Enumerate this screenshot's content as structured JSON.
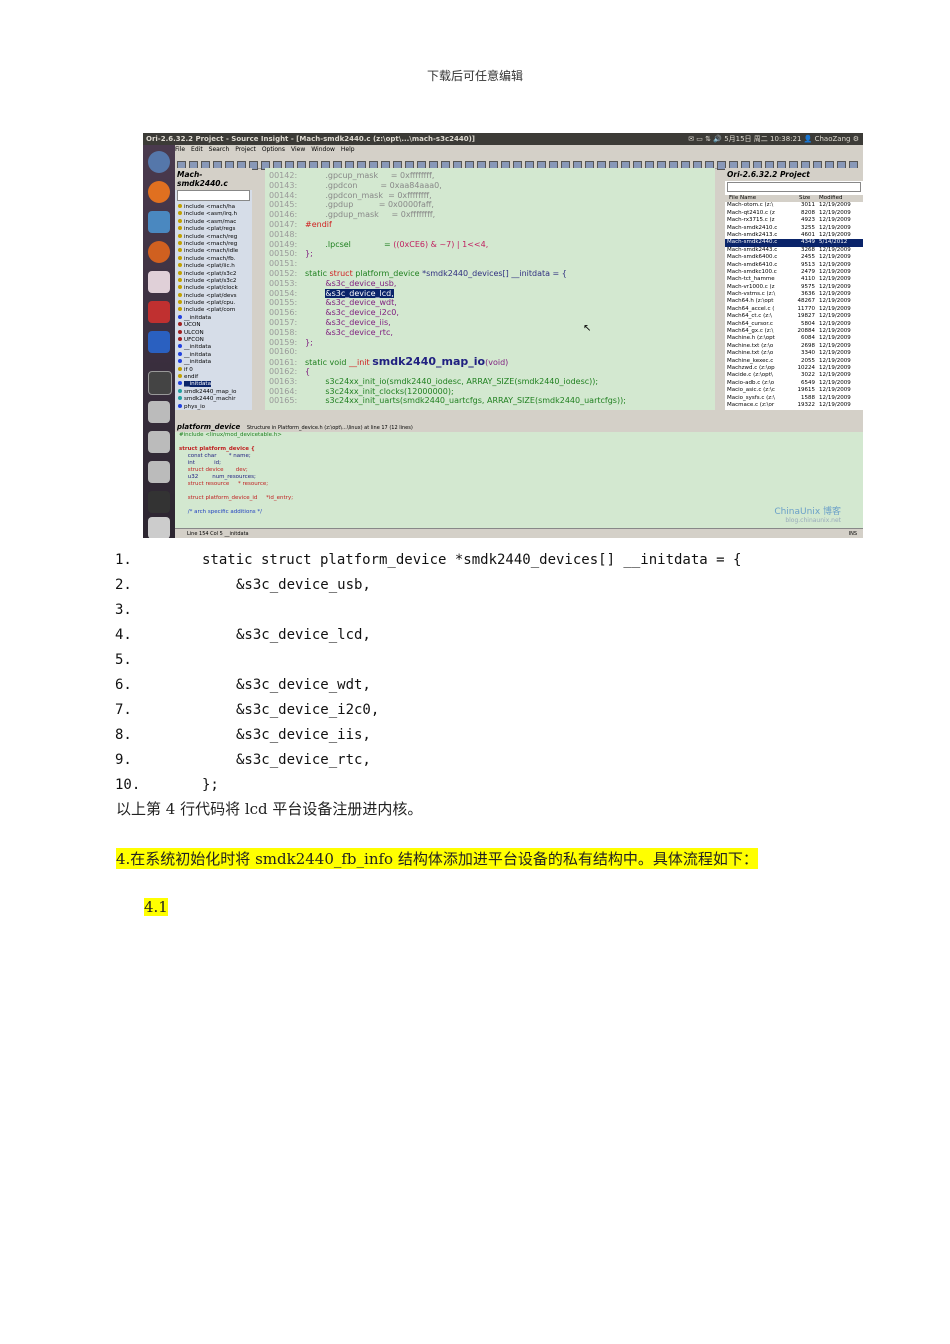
{
  "header": "下载后可任意编辑",
  "window": {
    "title": "Ori-2.6.32.2 Project - Source Insight - [Mach-smdk2440.c (z:\\opt\\...\\mach-s3c2440)]",
    "clock": "5月15日 周二 10:38:21",
    "user": "ChaoZang",
    "menu": [
      "File",
      "Edit",
      "Search",
      "Project",
      "Options",
      "View",
      "Window",
      "Help"
    ],
    "symbol_panel": {
      "title": "Mach-smdk2440.c",
      "items": [
        "include <mach/ha",
        "include <asm/irq.h",
        "include <asm/mac",
        "include <plat/regs",
        "include <mach/reg",
        "include <mach/reg",
        "include <mach/idle",
        "include <mach/fb.",
        "include <plat/iic.h",
        "include <plat/s3c2",
        "include <plat/s3c2",
        "include <plat/clock",
        "include <plat/devs",
        "include <plat/cpu.",
        "include <plat/com",
        "__initdata",
        "UCON",
        "ULCON",
        "UFCON",
        "__initdata",
        "__initdata",
        "__initdata",
        "if 0",
        "endif",
        "__initdata",
        "smdk2440_map_io",
        "smdk2440_machir",
        "phys_io"
      ],
      "selected": 24
    },
    "code": [
      {
        "n": "00142:",
        "s": [
          {
            "t": "        .gpcup_mask     = 0xffffffff,",
            "c": "#888"
          }
        ]
      },
      {
        "n": "00143:",
        "s": [
          {
            "t": "        .gpdcon         = 0xaa84aaa0,",
            "c": "#888"
          }
        ]
      },
      {
        "n": "00144:",
        "s": [
          {
            "t": "        .gpdcon_mask  = 0xffffffff,",
            "c": "#888"
          }
        ]
      },
      {
        "n": "00145:",
        "s": [
          {
            "t": "        .gpdup          = 0x0000faff,",
            "c": "#888"
          }
        ]
      },
      {
        "n": "00146:",
        "s": [
          {
            "t": "        .gpdup_mask     = 0xffffffff,",
            "c": "#888"
          }
        ]
      },
      {
        "n": "00147:",
        "s": [
          {
            "t": "#endif",
            "c": "#d02020"
          }
        ]
      },
      {
        "n": "00148:",
        "s": []
      },
      {
        "n": "00149:",
        "s": [
          {
            "t": "        .lpcsel             = ",
            "c": "#208020"
          },
          {
            "t": "((0xCE6) & ~7) | 1<<4,",
            "c": "#c02060"
          }
        ]
      },
      {
        "n": "00150:",
        "s": [
          {
            "t": "};",
            "c": "#802080"
          }
        ]
      },
      {
        "n": "00151:",
        "s": []
      },
      {
        "n": "00152:",
        "s": [
          {
            "t": "static ",
            "c": "#208020"
          },
          {
            "t": "struct ",
            "c": "#d02020"
          },
          {
            "t": "platform_device ",
            "c": "#208020"
          },
          {
            "t": "*smdk2440_devices[] __initdata = {",
            "c": "#303080"
          }
        ]
      },
      {
        "n": "00153:",
        "s": [
          {
            "t": "        &s3c_device_usb,",
            "c": "#802080"
          }
        ]
      },
      {
        "n": "00154:",
        "s": [
          {
            "t": "        ",
            "c": "#000"
          },
          {
            "t": "&s3c_device_lcd,",
            "c": "#fff",
            "bg": "#0a246a"
          }
        ]
      },
      {
        "n": "00155:",
        "s": [
          {
            "t": "        &s3c_device_wdt,",
            "c": "#802080"
          }
        ]
      },
      {
        "n": "00156:",
        "s": [
          {
            "t": "        &s3c_device_i2c0,",
            "c": "#802080"
          }
        ]
      },
      {
        "n": "00157:",
        "s": [
          {
            "t": "        &s3c_device_iis,",
            "c": "#802080"
          }
        ]
      },
      {
        "n": "00158:",
        "s": [
          {
            "t": "        &s3c_device_rtc,",
            "c": "#802080"
          }
        ]
      },
      {
        "n": "00159:",
        "s": [
          {
            "t": "};",
            "c": "#802080"
          }
        ]
      },
      {
        "n": "00160:",
        "s": []
      },
      {
        "n": "00161:",
        "s": [
          {
            "t": "static void ",
            "c": "#208020"
          },
          {
            "t": "__init ",
            "c": "#d02020"
          },
          {
            "t": "smdk2440_map_io",
            "c": "#202080",
            "b": true
          },
          {
            "t": "(void)",
            "c": "#802080"
          }
        ]
      },
      {
        "n": "00162:",
        "s": [
          {
            "t": "{",
            "c": "#802080"
          }
        ]
      },
      {
        "n": "00163:",
        "s": [
          {
            "t": "        s3c24xx_init_io(smdk2440_iodesc, ARRAY_SIZE(smdk2440_iodesc));",
            "c": "#208020"
          }
        ]
      },
      {
        "n": "00164:",
        "s": [
          {
            "t": "        s3c24xx_init_clocks(12000000);",
            "c": "#208020"
          }
        ]
      },
      {
        "n": "00165:",
        "s": [
          {
            "t": "        s3c24xx_init_uarts(smdk2440_uartcfgs, ARRAY_SIZE(smdk2440_uartcfgs));",
            "c": "#208020"
          }
        ]
      }
    ],
    "project_panel": {
      "title": "Ori-2.6.32.2 Project",
      "columns": [
        "File Name",
        "Size",
        "Modified"
      ],
      "rows": [
        [
          "Mach-otom.c (z:\\",
          "3011",
          "12/19/2009"
        ],
        [
          "Mach-qt2410.c (z",
          "8208",
          "12/19/2009"
        ],
        [
          "Mach-rx3715.c (z",
          "4923",
          "12/19/2009"
        ],
        [
          "Mach-smdk2410.c",
          "3255",
          "12/19/2009"
        ],
        [
          "Mach-smdk2413.c",
          "4601",
          "12/19/2009"
        ],
        [
          "Mach-smdk2440.c",
          "4349",
          "5/14/2012"
        ],
        [
          "Mach-smdk2443.c",
          "3268",
          "12/19/2009"
        ],
        [
          "Mach-smdk6400.c",
          "2455",
          "12/19/2009"
        ],
        [
          "Mach-smdk6410.c",
          "9513",
          "12/19/2009"
        ],
        [
          "Mach-smdkc100.c",
          "2479",
          "12/19/2009"
        ],
        [
          "Mach-tct_hamme",
          "4110",
          "12/19/2009"
        ],
        [
          "Mach-vr1000.c (z",
          "9575",
          "12/19/2009"
        ],
        [
          "Mach-vstms.c (z:\\",
          "3636",
          "12/19/2009"
        ],
        [
          "Mach64.h (z:\\opt",
          "48267",
          "12/19/2009"
        ],
        [
          "Mach64_accel.c (",
          "11770",
          "12/19/2009"
        ],
        [
          "Mach64_ct.c (z:\\",
          "19827",
          "12/19/2009"
        ],
        [
          "Mach64_cursor.c",
          "5804",
          "12/19/2009"
        ],
        [
          "Mach64_gx.c (z:\\",
          "20884",
          "12/19/2009"
        ],
        [
          "Machine.h (z:\\opt",
          "6084",
          "12/19/2009"
        ],
        [
          "Machine.txt (z:\\o",
          "2698",
          "12/19/2009"
        ],
        [
          "Machine.txt (z:\\o",
          "3340",
          "12/19/2009"
        ],
        [
          "Machine_kexec.c",
          "2055",
          "12/19/2009"
        ],
        [
          "Machzwd.c (z:\\op",
          "10224",
          "12/19/2009"
        ],
        [
          "Macide.c (z:\\opt\\",
          "3022",
          "12/19/2009"
        ],
        [
          "Macio-adb.c (z:\\o",
          "6549",
          "12/19/2009"
        ],
        [
          "Macio_asic.c (z:\\c",
          "19615",
          "12/19/2009"
        ],
        [
          "Macio_sysfs.c (z:\\",
          "1588",
          "12/19/2009"
        ],
        [
          "Macmace.c (z:\\or",
          "19322",
          "12/19/2009"
        ]
      ],
      "selected": 5
    },
    "context": {
      "title": "platform_device",
      "info": "Structure in Platform_device.h (z:\\opt\\...\\linux) at line 17 (12 lines)",
      "lines": [
        "#include <linux/mod_devicetable.h>",
        "",
        "struct platform_device {",
        "     const char       * name;",
        "     int           id;",
        "     struct device       dev;",
        "     u32        num_resources;",
        "     struct resource     * resource;",
        "",
        "     struct platform_device_id     *id_entry;",
        "",
        "     /* arch specific additions */"
      ],
      "watermark": "ChinaUnix 博客",
      "watermark_url": "blog.chinaunix.net"
    },
    "status": {
      "pos": "Line 154  Col 5   __initdata",
      "mode": "INS"
    }
  },
  "listing": [
    {
      "n": "1.",
      "code": "static struct platform_device *smdk2440_devices[] __initdata = {",
      "indent": 0
    },
    {
      "n": "2.",
      "code": "&s3c_device_usb,",
      "indent": 1
    },
    {
      "n": "3.",
      "code": "",
      "indent": 1
    },
    {
      "n": "4.",
      "code": "&s3c_device_lcd,",
      "indent": 1
    },
    {
      "n": "5.",
      "code": "",
      "indent": 1
    },
    {
      "n": "6.",
      "code": "&s3c_device_wdt,",
      "indent": 1
    },
    {
      "n": "7.",
      "code": "&s3c_device_i2c0,",
      "indent": 1
    },
    {
      "n": "8.",
      "code": "&s3c_device_iis,",
      "indent": 1
    },
    {
      "n": "9.",
      "code": "&s3c_device_rtc,",
      "indent": 1
    },
    {
      "n": "10.",
      "code": "};",
      "indent": 0
    }
  ],
  "para1": "以上第 4 行代码将 lcd 平台设备注册进内核。",
  "para2": "4.在系统初始化时将 smdk2440_fb_info 结构体添加进平台设备的私有结构中。具体流程如下：",
  "para3": "4.1"
}
